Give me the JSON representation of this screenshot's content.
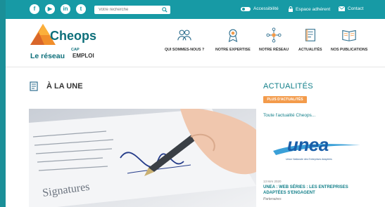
{
  "topbar": {
    "social": [
      {
        "name": "facebook-icon",
        "glyph": "f"
      },
      {
        "name": "youtube-icon",
        "glyph": "▶"
      },
      {
        "name": "linkedin-icon",
        "glyph": "in"
      },
      {
        "name": "twitter-icon",
        "glyph": "t"
      }
    ],
    "search_placeholder": "Votre recherche",
    "accessibility": "Accessibilité",
    "member_space": "Espace adhérent",
    "contact": "Contact"
  },
  "logo": {
    "word": "Cheops",
    "network": "Le réseau",
    "cap": "CAP",
    "emploi": "EMPLOI"
  },
  "nav": [
    {
      "label": "QUI SOMMES-NOUS ?",
      "icon": "people-icon"
    },
    {
      "label": "NOTRE EXPERTISE",
      "icon": "award-icon"
    },
    {
      "label": "NOTRE RÉSEAU",
      "icon": "network-icon"
    },
    {
      "label": "ACTUALITÉS",
      "icon": "document-icon"
    },
    {
      "label": "NOS PUBLICATIONS",
      "icon": "book-icon"
    }
  ],
  "main": {
    "section_title": "À LA UNE",
    "hero_caption": "Signatures"
  },
  "sidebar": {
    "title": "ACTUALITÉS",
    "more_button": "PLUS D'ACTUALITÉS",
    "all_news": "Toute l'actualité Cheops...",
    "partner_logo": "unea",
    "partner_subtitle": "Union Nationale des Entreprises Adaptées",
    "news": {
      "date": "13 MAI 2020",
      "headline": "UNEA : WEB SÉRIES : LES ENTREPRISES ADAPTÉES S'ENGAGENT",
      "category": "Partenaires"
    }
  },
  "colors": {
    "brand_teal": "#179aa5",
    "accent_orange": "#f39b4b",
    "link_teal": "#117f89"
  }
}
